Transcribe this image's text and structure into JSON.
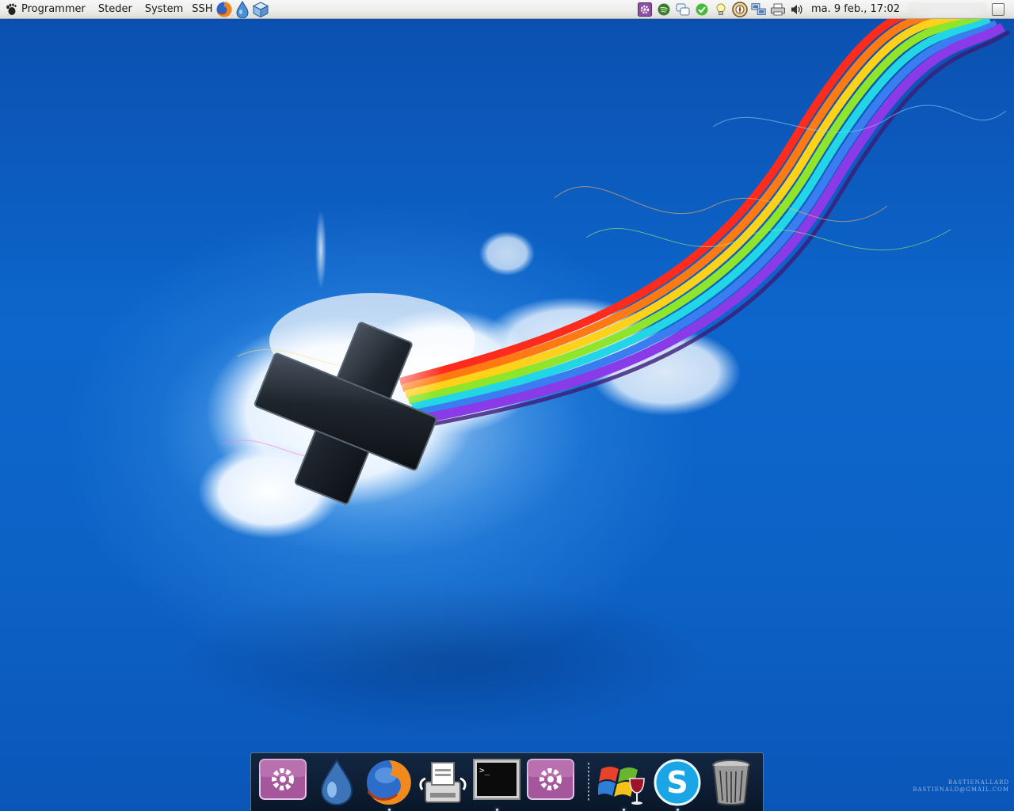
{
  "top_panel": {
    "menus": {
      "applications": "Programmer",
      "places": "Steder",
      "system": "System",
      "ssh": "SSH"
    },
    "launchers": [
      "firefox-icon",
      "deluge-drop-icon",
      "cube-icon"
    ],
    "tray_icons": [
      "settings-gear-icon",
      "spotify-icon",
      "chat-bubble-icon",
      "checkmark-icon",
      "lightbulb-icon",
      "compass-icon",
      "network-icon",
      "printer-icon",
      "volume-icon"
    ],
    "clock": "ma.  9 feb., 17:02"
  },
  "wallpaper": {
    "credit_line1": "BASTIENALLARD",
    "credit_line2": "BASTIENALD@GMAIL.COM",
    "colors": {
      "sky": "#0d66cc",
      "cloud": "#ffffff"
    }
  },
  "dock": {
    "items": [
      {
        "icon": "settings-gear-icon",
        "running": false
      },
      {
        "icon": "deluge-drop-icon",
        "running": false
      },
      {
        "icon": "firefox-icon",
        "running": true
      },
      {
        "icon": "scanner-icon",
        "running": false
      },
      {
        "icon": "terminal-icon",
        "running": true
      },
      {
        "icon": "settings-gear-icon",
        "running": false
      },
      {
        "icon": "wine-windows-icon",
        "running": true
      },
      {
        "icon": "skype-icon",
        "running": true
      },
      {
        "icon": "trash-icon",
        "running": false
      }
    ]
  }
}
